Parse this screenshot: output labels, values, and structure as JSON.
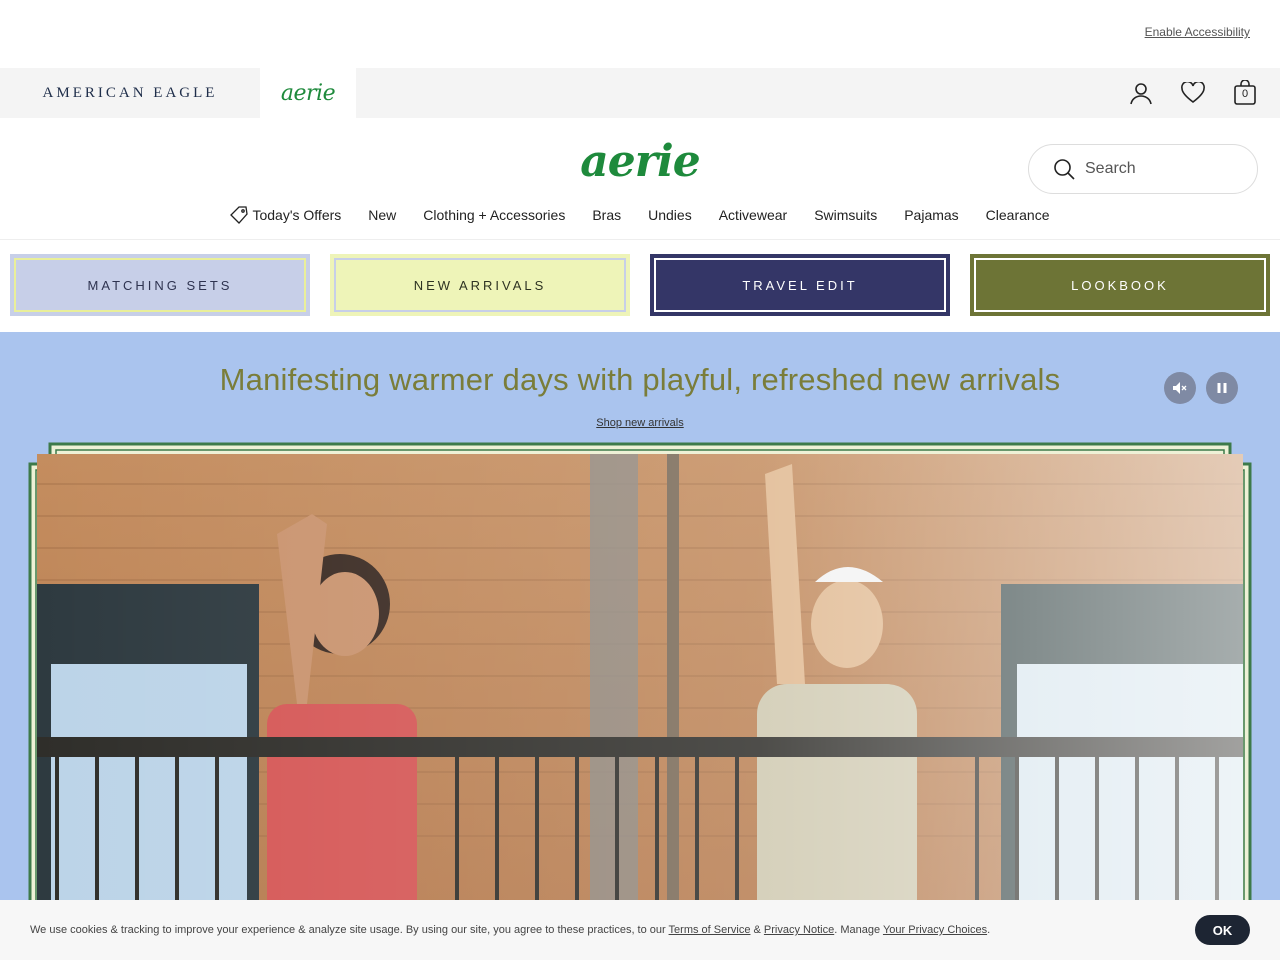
{
  "accessibility": {
    "link": "Enable Accessibility"
  },
  "brand_bar": {
    "american_eagle": "AMERICAN EAGLE",
    "aerie": "aerie",
    "bag_count": "0"
  },
  "header": {
    "logo": "aerie",
    "search_placeholder": "Search"
  },
  "nav": {
    "items": [
      "Today's Offers",
      "New",
      "Clothing + Accessories",
      "Bras",
      "Undies",
      "Activewear",
      "Swimsuits",
      "Pajamas",
      "Clearance"
    ]
  },
  "tiles": [
    "MATCHING SETS",
    "NEW ARRIVALS",
    "TRAVEL EDIT",
    "LOOKBOOK"
  ],
  "hero": {
    "title": "Manifesting warmer days with playful, refreshed new arrivals",
    "link": "Shop new arrivals"
  },
  "cookie": {
    "text_before": "We use cookies & tracking to improve your experience & analyze site usage. By using our site, you agree to these practices, to our ",
    "terms": "Terms of Service",
    "amp": " & ",
    "privacy": "Privacy Notice",
    "manage": ". Manage ",
    "choices": "Your Privacy Choices",
    "end": ".",
    "ok": "OK"
  },
  "colors": {
    "brand_green": "#1e8a3c",
    "hero_bg": "#aac4ee",
    "tile_matching": "#c7cfe8",
    "tile_new": "#eef4b8",
    "tile_travel": "#343667",
    "tile_lookbook": "#6d7436"
  }
}
